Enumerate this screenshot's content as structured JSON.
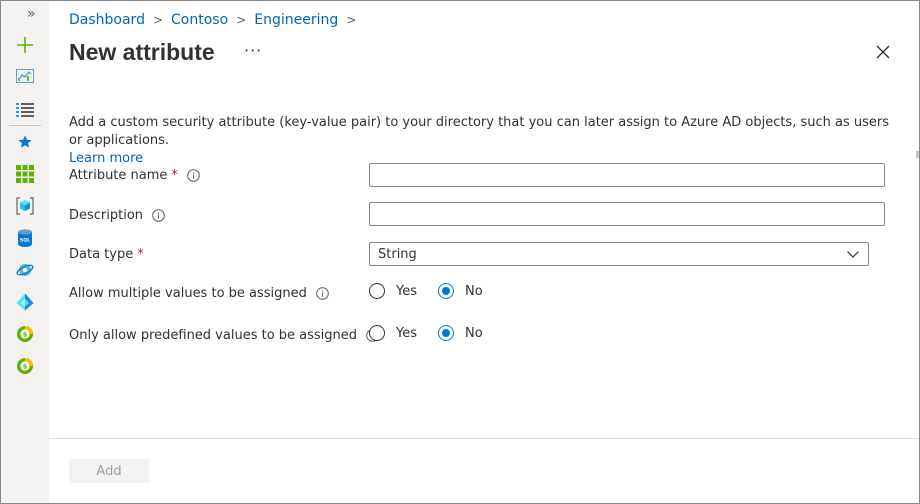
{
  "rail": {
    "expand_glyph": "»",
    "icons": [
      "plus-icon",
      "dashboard-icon",
      "all-services-icon",
      "favorites-star-icon",
      "all-resources-icon",
      "resource-groups-icon",
      "sql-database-icon",
      "cosmos-db-icon",
      "azure-ad-icon",
      "cost-management-icon",
      "advisor-icon"
    ]
  },
  "breadcrumb": {
    "items": [
      "Dashboard",
      "Contoso",
      "Engineering"
    ],
    "separator": ">"
  },
  "header": {
    "title": "New attribute",
    "more_glyph": "···"
  },
  "description": {
    "text": "Add a custom security attribute (key-value pair) to your directory that you can later assign to Azure AD objects, such as users or applications.",
    "link": "Learn more"
  },
  "form": {
    "attribute_name": {
      "label": "Attribute name",
      "required": "*",
      "value": ""
    },
    "description": {
      "label": "Description",
      "value": ""
    },
    "data_type": {
      "label": "Data type",
      "required": "*",
      "value": "String"
    },
    "allow_multiple": {
      "label": "Allow multiple values to be assigned",
      "yes": "Yes",
      "no": "No",
      "selected": "No"
    },
    "only_predefined": {
      "label": "Only allow predefined values to be assigned",
      "yes": "Yes",
      "no": "No",
      "selected": "No"
    }
  },
  "footer": {
    "add_label": "Add"
  },
  "colors": {
    "accent": "#0078d4",
    "link": "#0067b8",
    "required": "#a4262c"
  }
}
